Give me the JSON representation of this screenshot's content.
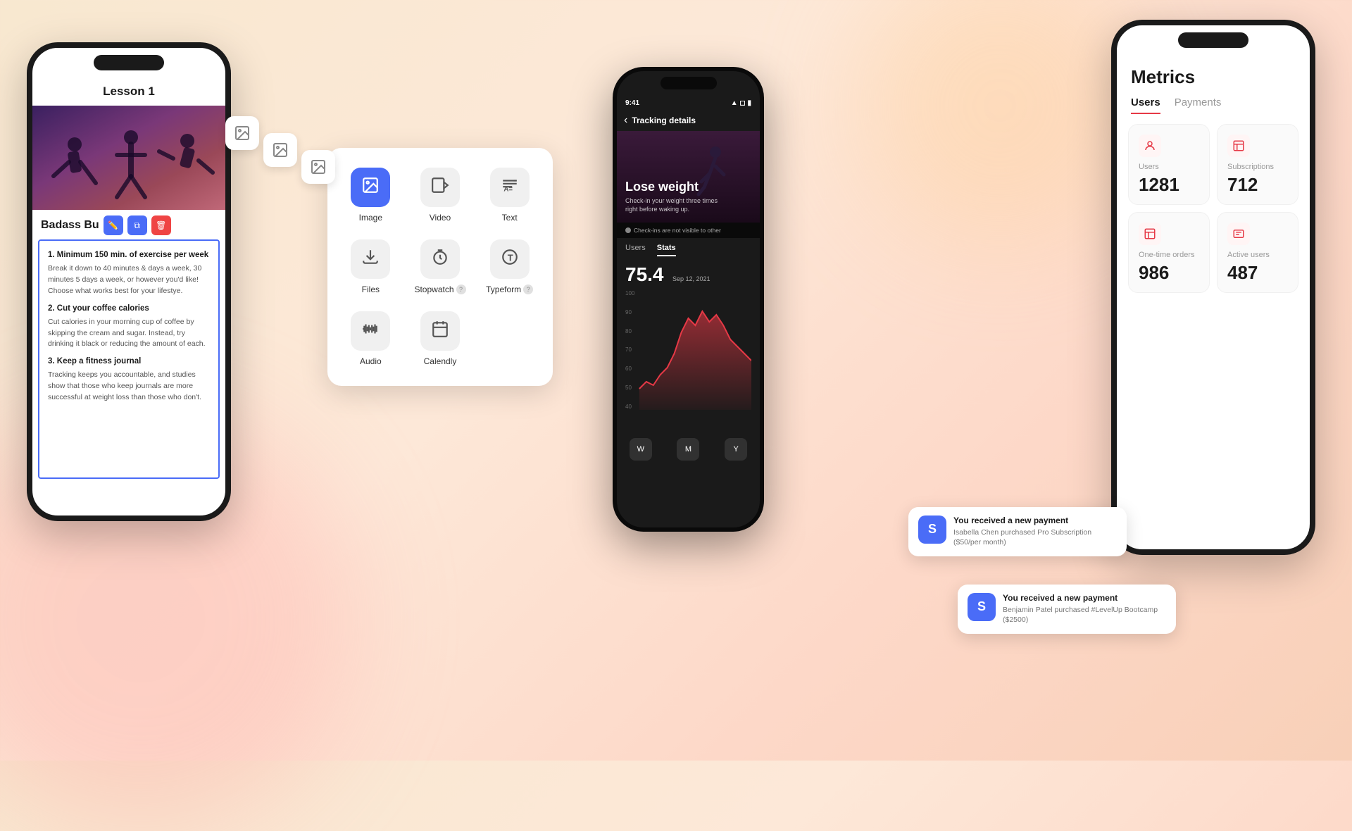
{
  "background": {
    "color_start": "#f8e8d0",
    "color_end": "#fdd8c8"
  },
  "left_phone": {
    "lesson_title": "Lesson 1",
    "badass_title": "Badass Bu",
    "content_items": [
      {
        "heading": "1. Minimum 150 min. of exercise per week",
        "body": "Break it down to 40 minutes & days a week, 30 minutes 5 days a week, or however you'd like! Choose what works best for your lifestye."
      },
      {
        "heading": "2. Cut your coffee calories",
        "body": "Cut calories in your morning cup of coffee by skipping the cream and sugar. Instead, try drinking it black or reducing the amount of each."
      },
      {
        "heading": "3. Keep a fitness journal",
        "body": "Tracking keeps you accountable, and studies show that those who keep journals are more successful at weight loss than those who don't."
      }
    ]
  },
  "popup": {
    "items": [
      {
        "label": "Image",
        "icon": "image",
        "active": true
      },
      {
        "label": "Video",
        "icon": "video",
        "active": false
      },
      {
        "label": "Text",
        "icon": "text",
        "active": false
      },
      {
        "label": "Files",
        "icon": "files",
        "active": false
      },
      {
        "label": "Stopwatch",
        "icon": "stopwatch",
        "active": false,
        "has_info": true
      },
      {
        "label": "Typeform",
        "icon": "typeform",
        "active": false,
        "has_info": true
      },
      {
        "label": "Audio",
        "icon": "audio",
        "active": false
      },
      {
        "label": "Calendly",
        "icon": "calendly",
        "active": false
      }
    ]
  },
  "center_phone": {
    "status_time": "9:41",
    "back_label": "Tracking details",
    "hero_title": "Lose weight",
    "hero_desc": "Check-in your weight three times right before waking up.",
    "warning_text": "Check-ins are not visible to other",
    "tabs": [
      "Users",
      "Stats"
    ],
    "active_tab": "Stats",
    "score": "75.4",
    "score_date": "Sep 12, 2021",
    "chart_labels": [
      "100",
      "90",
      "80",
      "70",
      "60",
      "50",
      "40"
    ],
    "bottom_nav": [
      "W",
      "M",
      "Y"
    ]
  },
  "right_phone": {
    "metrics_title": "Metrics",
    "tabs": [
      "Users",
      "Payments"
    ],
    "active_tab": "Users",
    "cards": [
      {
        "label": "Users",
        "value": "1281",
        "icon": "user"
      },
      {
        "label": "Subscriptions",
        "value": "712",
        "icon": "subscription"
      },
      {
        "label": "One-time orders",
        "value": "986",
        "icon": "orders"
      },
      {
        "label": "Active users",
        "value": "487",
        "icon": "active"
      }
    ]
  },
  "payment_notifications": [
    {
      "logo": "S",
      "title": "You received a new payment",
      "desc": "Isabella Chen purchased Pro Subscription ($50/per month)"
    },
    {
      "logo": "S",
      "title": "You received a new payment",
      "desc": "Benjamin Patel purchased #LevelUp Bootcamp ($2500)"
    }
  ]
}
